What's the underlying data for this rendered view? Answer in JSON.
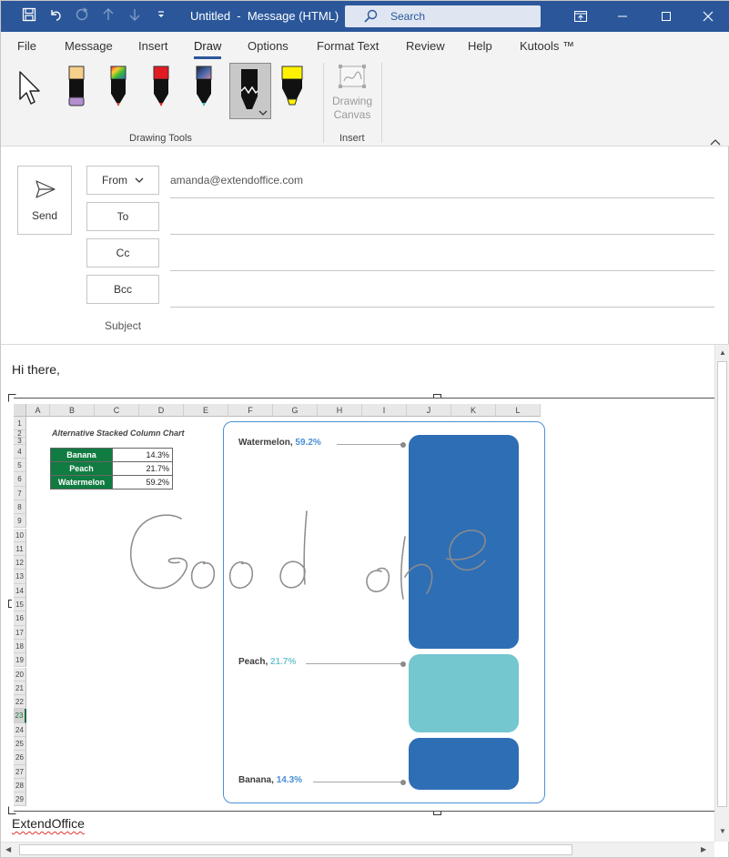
{
  "window": {
    "title": "Untitled  -  Message (HTML)",
    "search_label": "Search",
    "accent": "#2b579a"
  },
  "tabs": [
    "File",
    "Message",
    "Insert",
    "Draw",
    "Options",
    "Format Text",
    "Review",
    "Help",
    "Kutools ™"
  ],
  "active_tab": "Draw",
  "ribbon": {
    "drawing_tools_label": "Drawing Tools",
    "canvas_label_line1": "Drawing",
    "canvas_label_line2": "Canvas",
    "insert_label": "Insert",
    "tools": [
      "select-icon",
      "pen-purple-icon",
      "pen-rainbow-icon",
      "pen-red-icon",
      "pen-galaxy-icon",
      "pencil-icon",
      "highlighter-yellow-icon"
    ]
  },
  "compose": {
    "send_label": "Send",
    "from_label": "From",
    "from_value": "amanda@extendoffice.com",
    "to_label": "To",
    "cc_label": "Cc",
    "bcc_label": "Bcc",
    "subject_label": "Subject"
  },
  "body": {
    "greeting": "Hi there,",
    "signature": "ExtendOffice",
    "ink_text": "Good one"
  },
  "sheet": {
    "columns": [
      "A",
      "B",
      "C",
      "D",
      "E",
      "F",
      "G",
      "H",
      "I",
      "J",
      "K",
      "L"
    ],
    "rows": [
      "1",
      "2",
      "3",
      "4",
      "5",
      "6",
      "7",
      "8",
      "9",
      "10",
      "11",
      "12",
      "13",
      "14",
      "15",
      "16",
      "17",
      "18",
      "19",
      "20",
      "21",
      "22",
      "23",
      "24",
      "25",
      "26",
      "27",
      "28",
      "29"
    ],
    "selected_row": "23",
    "title": "Alternative Stacked Column Chart",
    "table": [
      {
        "category": "Banana",
        "value": "14.3%"
      },
      {
        "category": "Peach",
        "value": "21.7%"
      },
      {
        "category": "Watermelon",
        "value": "59.2%"
      }
    ]
  },
  "chart_data": {
    "type": "bar",
    "stacked": true,
    "title": "Alternative Stacked Column Chart",
    "categories": [
      "Banana",
      "Peach",
      "Watermelon"
    ],
    "values": [
      14.3,
      21.7,
      59.2
    ],
    "labels": [
      "14.3%",
      "21.7%",
      "59.2%"
    ],
    "colors": [
      "#2e6eb5",
      "#74c6cf",
      "#2e6eb5"
    ],
    "label_colors": [
      "#4a8fd6",
      "#74c6cf",
      "#4a8fd6"
    ],
    "grid": false,
    "legend": "none"
  }
}
